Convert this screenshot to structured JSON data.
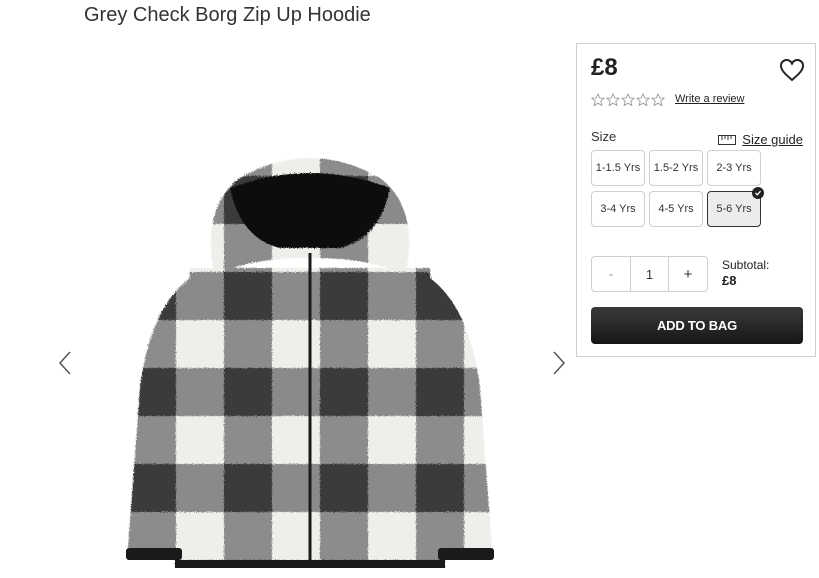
{
  "product": {
    "title": "Grey Check Borg Zip Up Hoodie"
  },
  "gallery": {
    "prev_icon": "chevron-left-icon",
    "next_icon": "chevron-right-icon"
  },
  "buybox": {
    "price": "£8",
    "wishlist_icon": "heart-icon",
    "rating": {
      "stars_filled": 0,
      "stars_total": 5
    },
    "review_link": "Write a review",
    "size_label": "Size",
    "size_guide_icon": "ruler-icon",
    "size_guide_label": "Size guide",
    "sizes": [
      "1-1.5 Yrs",
      "1.5-2 Yrs",
      "2-3 Yrs",
      "3-4 Yrs",
      "4-5 Yrs",
      "5-6 Yrs"
    ],
    "selected_size": "5-6 Yrs",
    "quantity": {
      "minus": "-",
      "value": "1",
      "plus": "+"
    },
    "subtotal_label": "Subtotal:",
    "subtotal_value": "£8",
    "add_to_bag": "ADD TO BAG"
  },
  "colors": {
    "button_dark": "#222222",
    "border": "#cfcfcf"
  }
}
